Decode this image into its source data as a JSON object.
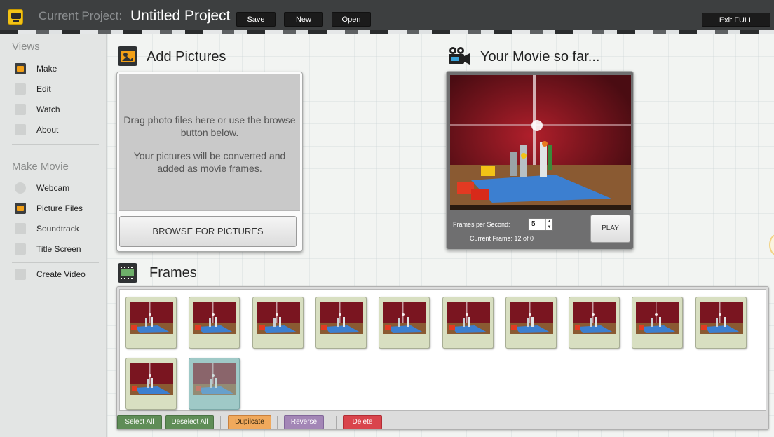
{
  "header": {
    "label": "Current Project:",
    "project_title": "Untitled Project",
    "save_label": "Save",
    "new_label": "New",
    "open_label": "Open",
    "exit_label": "Exit FULL SCREEN"
  },
  "sidebar": {
    "views_heading": "Views",
    "views": [
      {
        "label": "Make",
        "icon": "movie-camera-icon"
      },
      {
        "label": "Edit",
        "icon": "grid-icon"
      },
      {
        "label": "Watch",
        "icon": "tv-icon"
      },
      {
        "label": "About",
        "icon": "info-icon"
      }
    ],
    "make_heading": "Make Movie",
    "make_items": [
      {
        "label": "Webcam",
        "icon": "webcam-icon"
      },
      {
        "label": "Picture Files",
        "icon": "picture-icon"
      },
      {
        "label": "Soundtrack",
        "icon": "music-icon"
      },
      {
        "label": "Title Screen",
        "icon": "title-icon"
      },
      {
        "label": "Create Video",
        "icon": "film-icon"
      }
    ]
  },
  "add_pictures": {
    "title": "Add Pictures",
    "drop_text_1": "Drag photo files here or use the browse button below.",
    "drop_text_2": "Your pictures will be converted and added as movie frames.",
    "browse_label": "BROWSE FOR PICTURES"
  },
  "movie": {
    "title": "Your Movie so far...",
    "fps_label": "Frames per Second:",
    "fps_value": "5",
    "current_frame": "Current Frame:  12 of 0",
    "play_label": "PLAY"
  },
  "frames": {
    "title": "Frames",
    "count": 12,
    "selected_index": 11,
    "buttons": {
      "select_all": "Select All",
      "deselect_all": "Deselect All",
      "duplicate": "Dupilcate",
      "reverse": "Reverse",
      "delete": "Delete"
    }
  },
  "colors": {
    "header_bg": "#3d3f40",
    "select_green": "#5f8d57",
    "duplicate_orange": "#f0a95c",
    "reverse_purple": "#a386b6",
    "delete_red": "#d9444c",
    "selected_frame": "#9fc9c7"
  }
}
